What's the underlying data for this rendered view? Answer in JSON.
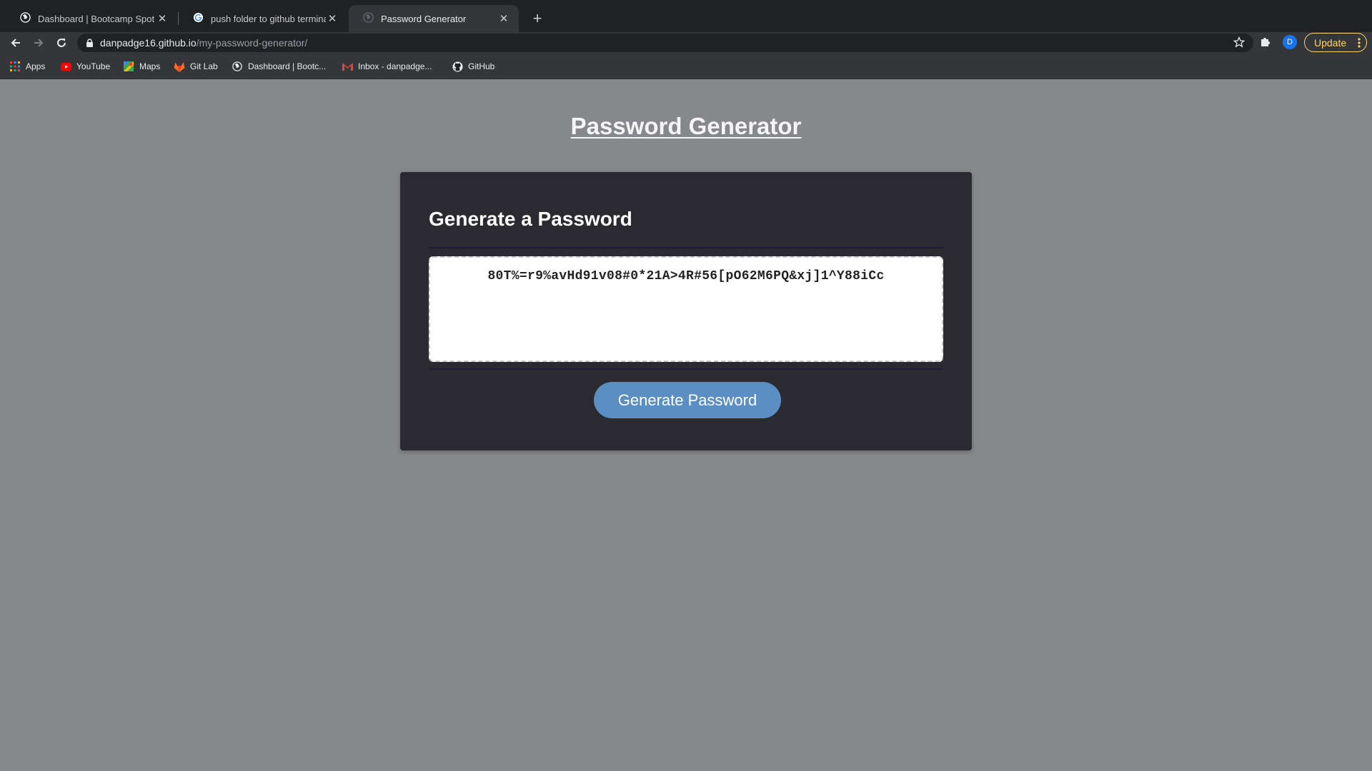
{
  "browser": {
    "tabs": [
      {
        "title": "Dashboard | Bootcamp Spot",
        "icon": "globe-icon"
      },
      {
        "title": "push folder to github terminal",
        "icon": "google-icon"
      },
      {
        "title": "Password Generator",
        "icon": "globe-icon",
        "active": true
      }
    ],
    "url": {
      "host": "danpadge16.github.io",
      "path": "/my-password-generator/"
    },
    "profile_initial": "D",
    "update_label": "Update",
    "bookmarks": [
      {
        "label": "Apps",
        "icon": "apps-grid-icon"
      },
      {
        "label": "YouTube",
        "icon": "youtube-icon"
      },
      {
        "label": "Maps",
        "icon": "maps-icon"
      },
      {
        "label": "Git Lab",
        "icon": "gitlab-icon"
      },
      {
        "label": "Dashboard | Bootc...",
        "icon": "globe-icon"
      },
      {
        "label": "Inbox - danpadge...",
        "icon": "gmail-icon"
      },
      {
        "label": "GitHub",
        "icon": "github-icon"
      }
    ]
  },
  "page": {
    "title": "Password Generator",
    "card": {
      "header": "Generate a Password",
      "password": "80T%=r9%avHd91v08#0*21A>4R#56[pO62M6PQ&xj]1^Y88iCc",
      "button_label": "Generate Password"
    }
  },
  "colors": {
    "page_bg": "#87888c",
    "card_bg": "#2b2a30",
    "button_bg": "#5b8fc4",
    "update_accent": "#fdd663"
  }
}
